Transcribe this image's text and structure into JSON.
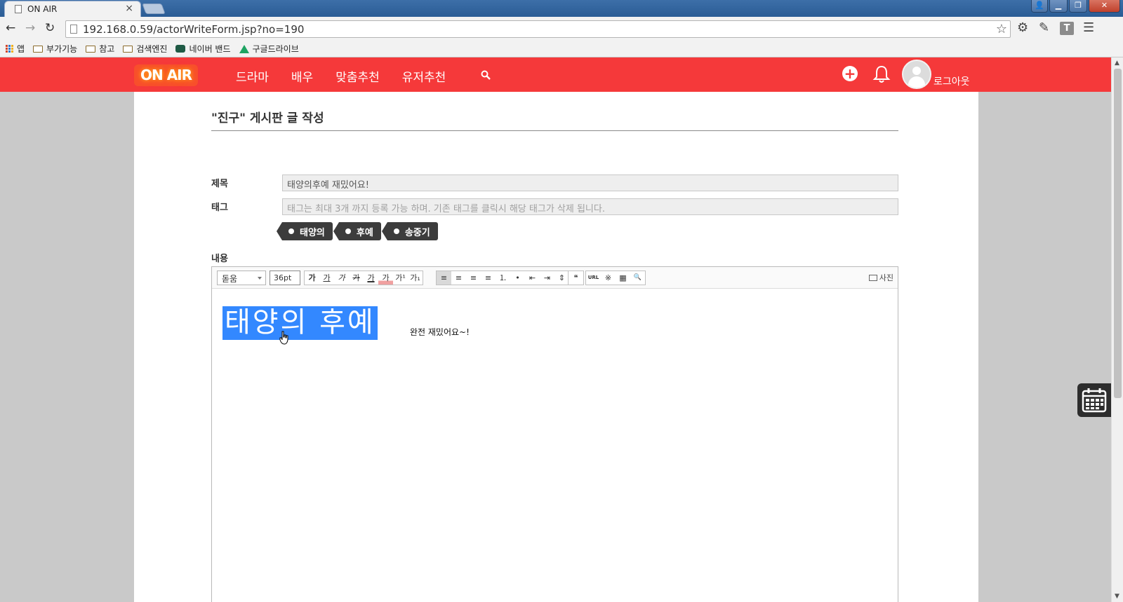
{
  "browser": {
    "tab_title": "ON AIR",
    "tab_close": "×",
    "url": "192.168.0.59/actorWriteForm.jsp?no=190",
    "extension_letter": "T",
    "bookmarks": [
      "앱",
      "부가기능",
      "참고",
      "검색엔진",
      "네이버 밴드",
      "구글드라이브"
    ]
  },
  "header": {
    "logo": "ON AIR",
    "nav": [
      "드라마",
      "배우",
      "맞춤추천",
      "유저추천"
    ],
    "logout": "로그아웃",
    "brand_color": "#f5393a"
  },
  "form": {
    "page_title": "\"진구\" 게시판 글 작성",
    "title_label": "제목",
    "title_value": "태양의후예 재밌어요!",
    "tag_label": "태그",
    "tag_placeholder": "태그는 최대 3개 까지 등록 가능 하며. 기존 태그를 클릭시 해당 태그가 삭제 됩니다.",
    "tags": [
      "태양의",
      "후예",
      "송중기"
    ],
    "content_label": "내용"
  },
  "editor": {
    "font": "돋움",
    "font_size": "36pt",
    "photo_button": "사진",
    "toolbar_buttons": [
      "가",
      "가",
      "가",
      "가",
      "가",
      "가",
      "가¹",
      "가₁",
      "≡",
      "≡",
      "≡",
      "≡",
      "⒈",
      "•",
      "⇤",
      "⇥",
      "⇕",
      "❝",
      "URL",
      "※",
      "▦",
      "🔍"
    ],
    "selected_text": "태양의 후예",
    "body_text": "완전 재밌어요~!",
    "highlight_color": "#3388ff"
  }
}
